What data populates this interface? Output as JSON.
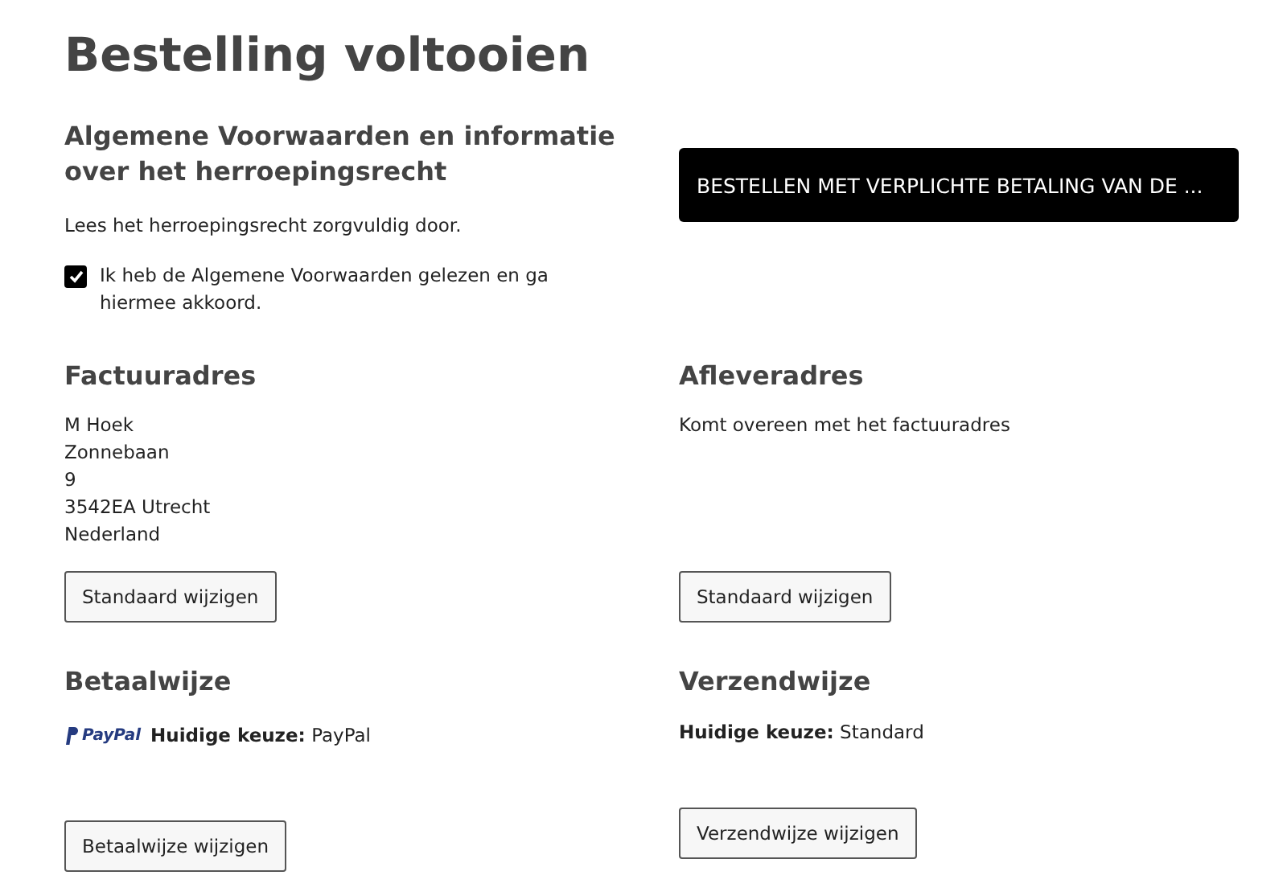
{
  "title": "Bestelling voltooien",
  "terms": {
    "heading": "Algemene Voorwaarden en informatie over het herroepingsrecht",
    "note": "Lees het herroepingsrecht zorgvuldig door.",
    "agree_label": "Ik heb de Algemene Voorwaarden gelezen en ga hiermee akkoord.",
    "checked": true
  },
  "order_button": "BESTELLEN MET VERPLICHTE BETALING VAN DE ...",
  "billing": {
    "heading": "Factuuradres",
    "lines": [
      "M Hoek",
      "Zonnebaan",
      "9",
      "3542EA Utrecht",
      "Nederland"
    ],
    "button": "Standaard wijzigen"
  },
  "shipping": {
    "heading": "Afleveradres",
    "lines": [
      "Komt overeen met het factuuradres"
    ],
    "button": "Standaard wijzigen"
  },
  "payment": {
    "heading": "Betaalwijze",
    "logo_text": "PayPal",
    "choice_label": "Huidige keuze:",
    "choice": "PayPal",
    "button": "Betaalwijze wijzigen"
  },
  "delivery": {
    "heading": "Verzendwijze",
    "choice_label": "Huidige keuze:",
    "choice": "Standard",
    "button": "Verzendwijze wijzigen"
  }
}
